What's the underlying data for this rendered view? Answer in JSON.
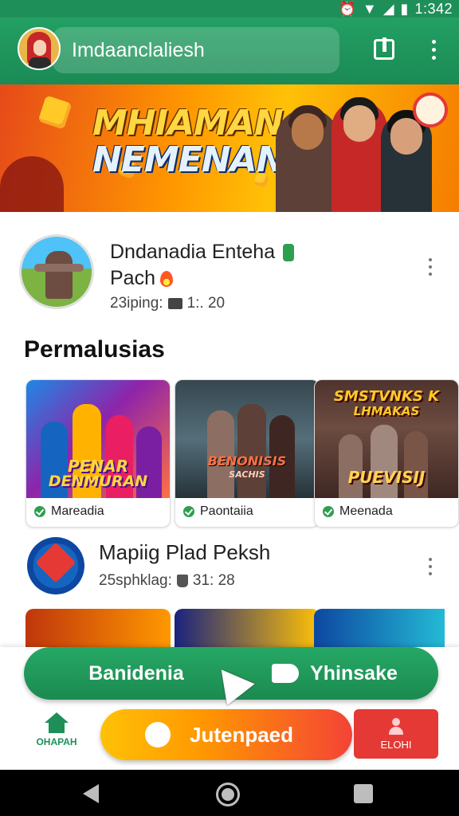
{
  "status_bar": {
    "time": "1:342"
  },
  "app_bar": {
    "title": "Imdaanclaliesh"
  },
  "banner": {
    "line1": "MHIAMAN",
    "line2": "NEMENAN"
  },
  "featured": {
    "title_line1": "Dndanadia Enteha",
    "title_line2": "Pach",
    "meta_left": "23iping:",
    "meta_right": "1:. 20"
  },
  "section": {
    "title": "Permalusias"
  },
  "cards": [
    {
      "art_line1": "PENAR",
      "art_line2": "DENMURAN",
      "label": "Mareadia"
    },
    {
      "art_line1": "BENONISIS",
      "art_line2": "SACHIS",
      "label": "Paontaiia"
    },
    {
      "art_line1": "SMSTVNKS K",
      "art_line2": "LHMAKAS",
      "art_line3": "PUEVISIJ",
      "label": "Meenada"
    }
  ],
  "item2": {
    "title": "Mapiig Plad Peksh",
    "meta_left": "25sphklag:",
    "meta_right": "31: 28"
  },
  "split_button": {
    "left": "Banidenia",
    "right": "Yhinsake"
  },
  "bottom_nav": {
    "home_label": "OHAPAH",
    "cta_label": "Jutenpaed",
    "profile_label": "ELOHI"
  },
  "colors": {
    "primary_green": "#1f8f5a",
    "cta_yellow": "#ffc107",
    "cta_red": "#f44336",
    "profile_red": "#e53935"
  },
  "icons": [
    "wifi-icon",
    "signal-icon",
    "battery-icon",
    "alarm-icon",
    "book-icon",
    "more-vert-icon",
    "home-icon",
    "person-icon",
    "check-icon",
    "back-icon",
    "recents-icon"
  ]
}
